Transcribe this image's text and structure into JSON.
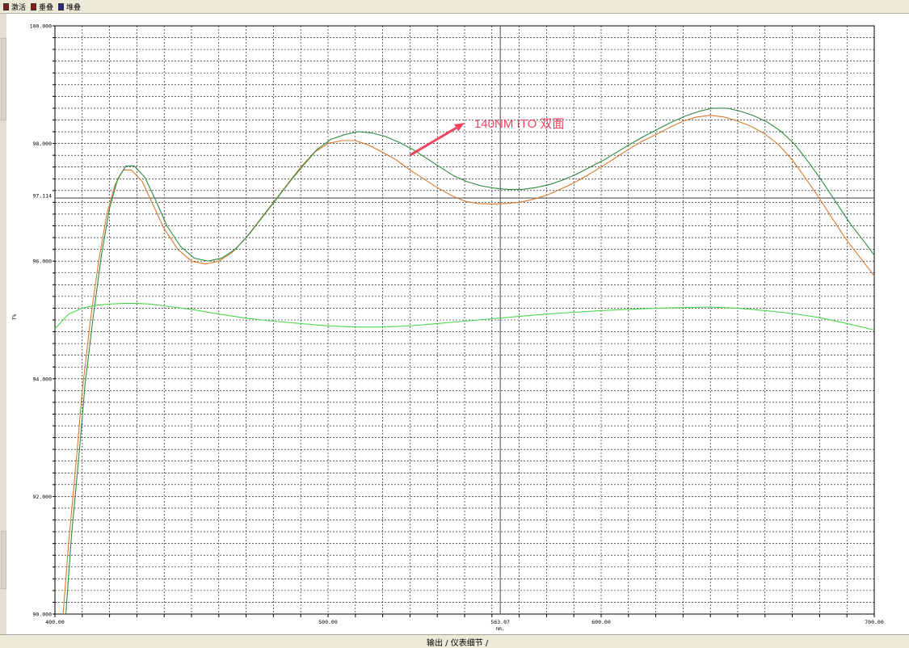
{
  "toolbar": {
    "tabs": [
      {
        "label": "激活",
        "icon": "window-icon",
        "color": "#8b1a1a"
      },
      {
        "label": "垂叠",
        "icon": "window-icon",
        "color": "#8b1a1a"
      },
      {
        "label": "堆叠",
        "icon": "window-icon",
        "color": "#2a2a8b"
      }
    ]
  },
  "bottom_bar": {
    "text": "输出 / 仪表细节 /"
  },
  "chart_data": {
    "type": "line",
    "xlabel": "nm.",
    "ylabel": "T%",
    "xlim": [
      400,
      700
    ],
    "ylim": [
      90,
      100
    ],
    "x_ticks": [
      "400.00",
      "500.00",
      "563.07",
      "600.00",
      "700.00"
    ],
    "y_ticks": [
      "100.000",
      "98.000",
      "97.114",
      "96.000",
      "94.000",
      "92.000",
      "90.000"
    ],
    "cursor": {
      "x": 563.07,
      "y": 97.114
    },
    "grid": true,
    "annotation": {
      "text": "140NM ITO  双面",
      "color": "#ef4560",
      "arrow_from": [
        530,
        97.8
      ],
      "arrow_to": [
        550,
        98.35
      ]
    },
    "series": [
      {
        "color": "#d97a2c",
        "x": [
          403,
          405,
          408,
          410,
          413,
          416,
          419,
          422,
          425,
          428,
          432,
          436,
          440,
          445,
          450,
          455,
          460,
          465,
          470,
          475,
          480,
          485,
          490,
          495,
          500,
          505,
          510,
          515,
          520,
          525,
          530,
          535,
          540,
          545,
          550,
          555,
          560,
          565,
          570,
          575,
          580,
          585,
          590,
          595,
          600,
          605,
          610,
          615,
          620,
          625,
          630,
          635,
          640,
          645,
          650,
          655,
          660,
          665,
          670,
          675,
          680,
          685,
          690,
          695,
          700
        ],
        "y": [
          90.0,
          91.2,
          92.7,
          93.8,
          95.0,
          96.0,
          96.8,
          97.3,
          97.55,
          97.55,
          97.35,
          96.95,
          96.55,
          96.2,
          96.0,
          95.95,
          96.0,
          96.15,
          96.4,
          96.7,
          97.0,
          97.3,
          97.6,
          97.85,
          98.0,
          98.05,
          98.05,
          97.97,
          97.85,
          97.72,
          97.55,
          97.4,
          97.25,
          97.12,
          97.02,
          96.98,
          96.97,
          96.98,
          97.0,
          97.05,
          97.12,
          97.22,
          97.33,
          97.46,
          97.6,
          97.75,
          97.9,
          98.04,
          98.15,
          98.27,
          98.38,
          98.45,
          98.48,
          98.45,
          98.38,
          98.29,
          98.16,
          97.98,
          97.72,
          97.4,
          97.06,
          96.7,
          96.35,
          96.05,
          95.75
        ]
      },
      {
        "color": "#2e8b3e",
        "x": [
          404,
          406,
          409,
          411,
          414,
          417,
          420,
          423,
          426,
          429,
          433,
          437,
          441,
          446,
          451,
          456,
          461,
          466,
          471,
          476,
          481,
          486,
          491,
          496,
          501,
          506,
          511,
          516,
          521,
          526,
          531,
          536,
          541,
          546,
          551,
          556,
          561,
          566,
          571,
          576,
          581,
          586,
          591,
          596,
          601,
          606,
          611,
          616,
          621,
          626,
          631,
          636,
          641,
          646,
          651,
          656,
          661,
          666,
          671,
          676,
          681,
          686,
          691,
          696,
          700
        ],
        "y": [
          90.0,
          91.3,
          92.8,
          93.9,
          95.05,
          96.1,
          96.9,
          97.4,
          97.62,
          97.62,
          97.42,
          97.02,
          96.6,
          96.25,
          96.05,
          96.0,
          96.05,
          96.2,
          96.45,
          96.75,
          97.05,
          97.35,
          97.63,
          97.9,
          98.07,
          98.15,
          98.2,
          98.18,
          98.12,
          98.02,
          97.9,
          97.75,
          97.6,
          97.45,
          97.35,
          97.28,
          97.24,
          97.22,
          97.22,
          97.25,
          97.3,
          97.38,
          97.48,
          97.6,
          97.72,
          97.86,
          98.0,
          98.13,
          98.25,
          98.37,
          98.47,
          98.55,
          98.6,
          98.6,
          98.55,
          98.47,
          98.36,
          98.2,
          97.98,
          97.68,
          97.35,
          97.0,
          96.65,
          96.35,
          96.1
        ]
      },
      {
        "color": "#4cd64c",
        "x": [
          400,
          405,
          410,
          415,
          420,
          425,
          430,
          435,
          440,
          450,
          460,
          470,
          480,
          490,
          500,
          510,
          520,
          530,
          540,
          550,
          560,
          570,
          580,
          590,
          600,
          610,
          620,
          630,
          640,
          650,
          660,
          670,
          680,
          690,
          700
        ],
        "y": [
          94.85,
          95.1,
          95.2,
          95.25,
          95.27,
          95.28,
          95.28,
          95.27,
          95.24,
          95.18,
          95.1,
          95.03,
          94.98,
          94.94,
          94.9,
          94.88,
          94.88,
          94.9,
          94.94,
          94.98,
          95.02,
          95.06,
          95.1,
          95.13,
          95.16,
          95.18,
          95.2,
          95.21,
          95.22,
          95.2,
          95.16,
          95.11,
          95.04,
          94.94,
          94.83
        ]
      }
    ]
  }
}
